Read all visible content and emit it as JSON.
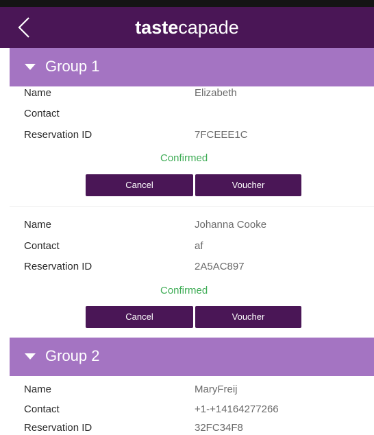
{
  "app": {
    "title_bold": "taste",
    "title_light": "capade",
    "back_icon": "chevron-left-icon"
  },
  "colors": {
    "appbar": "#4a1656",
    "group_header": "#a474c2",
    "button": "#4a1656",
    "confirmed": "#3eac55"
  },
  "groups": [
    {
      "label": "Group 1",
      "reservations": [
        {
          "name_label": "Name",
          "name": "Elizabeth",
          "contact_label": "Contact",
          "contact": "",
          "id_label": "Reservation ID",
          "id": "7FCEEE1C",
          "status": "Confirmed",
          "cancel_label": "Cancel",
          "voucher_label": "Voucher"
        },
        {
          "name_label": "Name",
          "name": "Johanna Cooke",
          "contact_label": "Contact",
          "contact": "af",
          "id_label": "Reservation ID",
          "id": "2A5AC897",
          "status": "Confirmed",
          "cancel_label": "Cancel",
          "voucher_label": "Voucher"
        }
      ]
    },
    {
      "label": "Group 2",
      "reservations": [
        {
          "name_label": "Name",
          "name": "MaryFreij",
          "contact_label": "Contact",
          "contact": "+1-+14164277266",
          "id_label": "Reservation ID",
          "id": "32FC34F8"
        }
      ]
    }
  ]
}
